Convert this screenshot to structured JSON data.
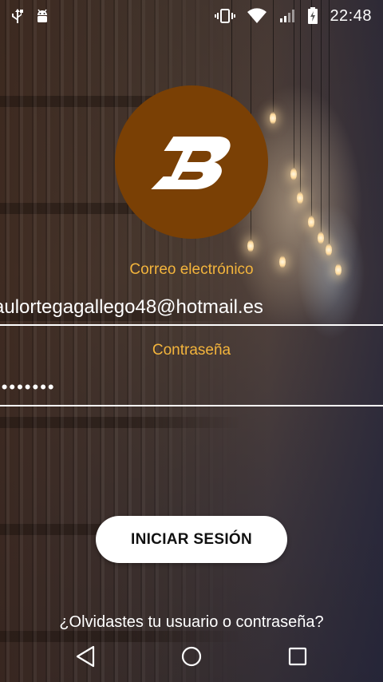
{
  "status_bar": {
    "time": "22:48",
    "icons": [
      "usb-icon",
      "android-debug-icon",
      "vibrate-icon",
      "wifi-icon",
      "signal-icon",
      "battery-charging-icon"
    ]
  },
  "logo": {
    "letter": "B",
    "background": "#7a4005"
  },
  "form": {
    "email_label": "Correo electrónico",
    "email_value": "aulortegagallego48@hotmail.es",
    "password_label": "Contraseña",
    "password_value": "••••••••",
    "label_color": "#f3b43c"
  },
  "login_button": {
    "label": "INICIAR SESIÓN"
  },
  "forgot_link": {
    "label": "¿Olvidastes tu usuario o contraseña?"
  },
  "nav_bar": {
    "icons": [
      "back-icon",
      "home-icon",
      "recents-icon"
    ]
  }
}
